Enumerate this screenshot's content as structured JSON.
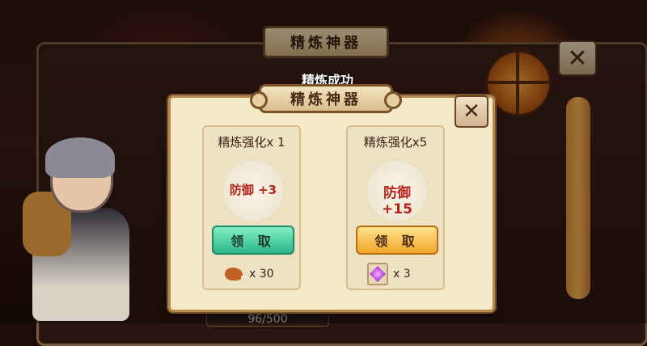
{
  "background_dialog": {
    "title": "精炼神器",
    "close": "✕",
    "progress": "96/500"
  },
  "front_dialog": {
    "success_message": "精炼成功",
    "title": "精炼神器",
    "close": "✕",
    "cards": [
      {
        "title": "精炼强化x 1",
        "stat": "防御 +3",
        "button": "领 取",
        "reward_icon": "meat-icon",
        "reward_count": "x 30"
      },
      {
        "title": "精炼强化x5",
        "stat": "防御 +15",
        "button": "领 取",
        "reward_icon": "purple-gem-icon",
        "reward_count": "x 3"
      }
    ]
  },
  "colors": {
    "panel": "#f6e9c8",
    "stat_red": "#b5231c",
    "teal_button": "#2fb58a",
    "gold_button": "#f0a62a"
  }
}
